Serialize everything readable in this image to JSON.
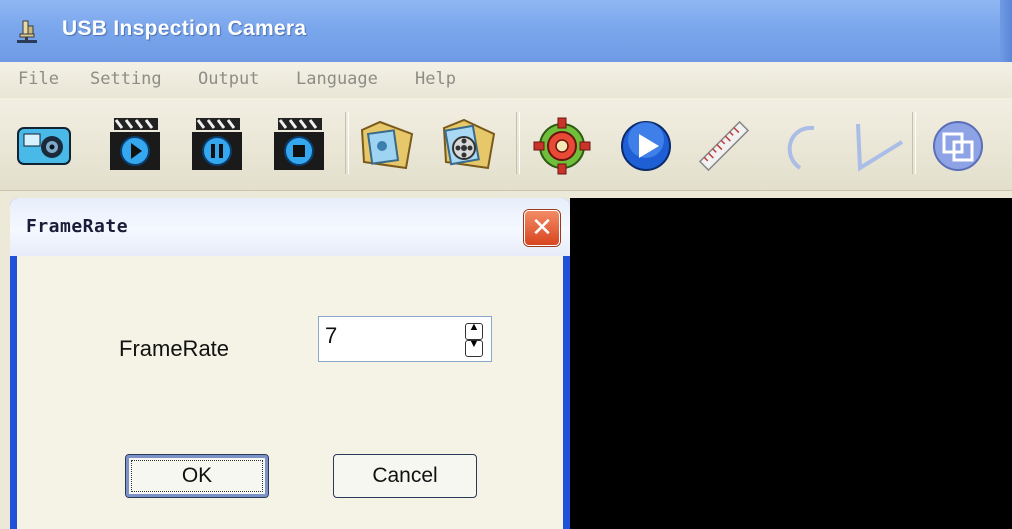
{
  "window": {
    "title": "USB Inspection Camera",
    "icon": "microscope-icon"
  },
  "menu": {
    "items": [
      "File",
      "Setting",
      "Output",
      "Language",
      "Help"
    ]
  },
  "toolbar": {
    "buttons": [
      {
        "icon": "camera-snapshot-icon"
      },
      {
        "icon": "video-record-icon"
      },
      {
        "icon": "video-pause-icon"
      },
      {
        "icon": "video-stop-icon"
      },
      {
        "icon": "open-image-folder-icon"
      },
      {
        "icon": "open-video-folder-icon"
      },
      {
        "icon": "settings-gear-icon"
      },
      {
        "icon": "play-icon"
      },
      {
        "icon": "ruler-icon"
      },
      {
        "icon": "arc-measure-icon"
      },
      {
        "icon": "angle-measure-icon"
      },
      {
        "icon": "overlay-window-icon"
      }
    ]
  },
  "dialog": {
    "title": "FrameRate",
    "close_icon": "close-icon",
    "label": "FrameRate",
    "value": "7",
    "ok_label": "OK",
    "cancel_label": "Cancel"
  },
  "colors": {
    "titlebar": "#7aa6ec",
    "dialog_frame": "#1f52d8",
    "close_button": "#d7461f",
    "video_area": "#000000",
    "dialog_body": "#f5f3e6"
  }
}
